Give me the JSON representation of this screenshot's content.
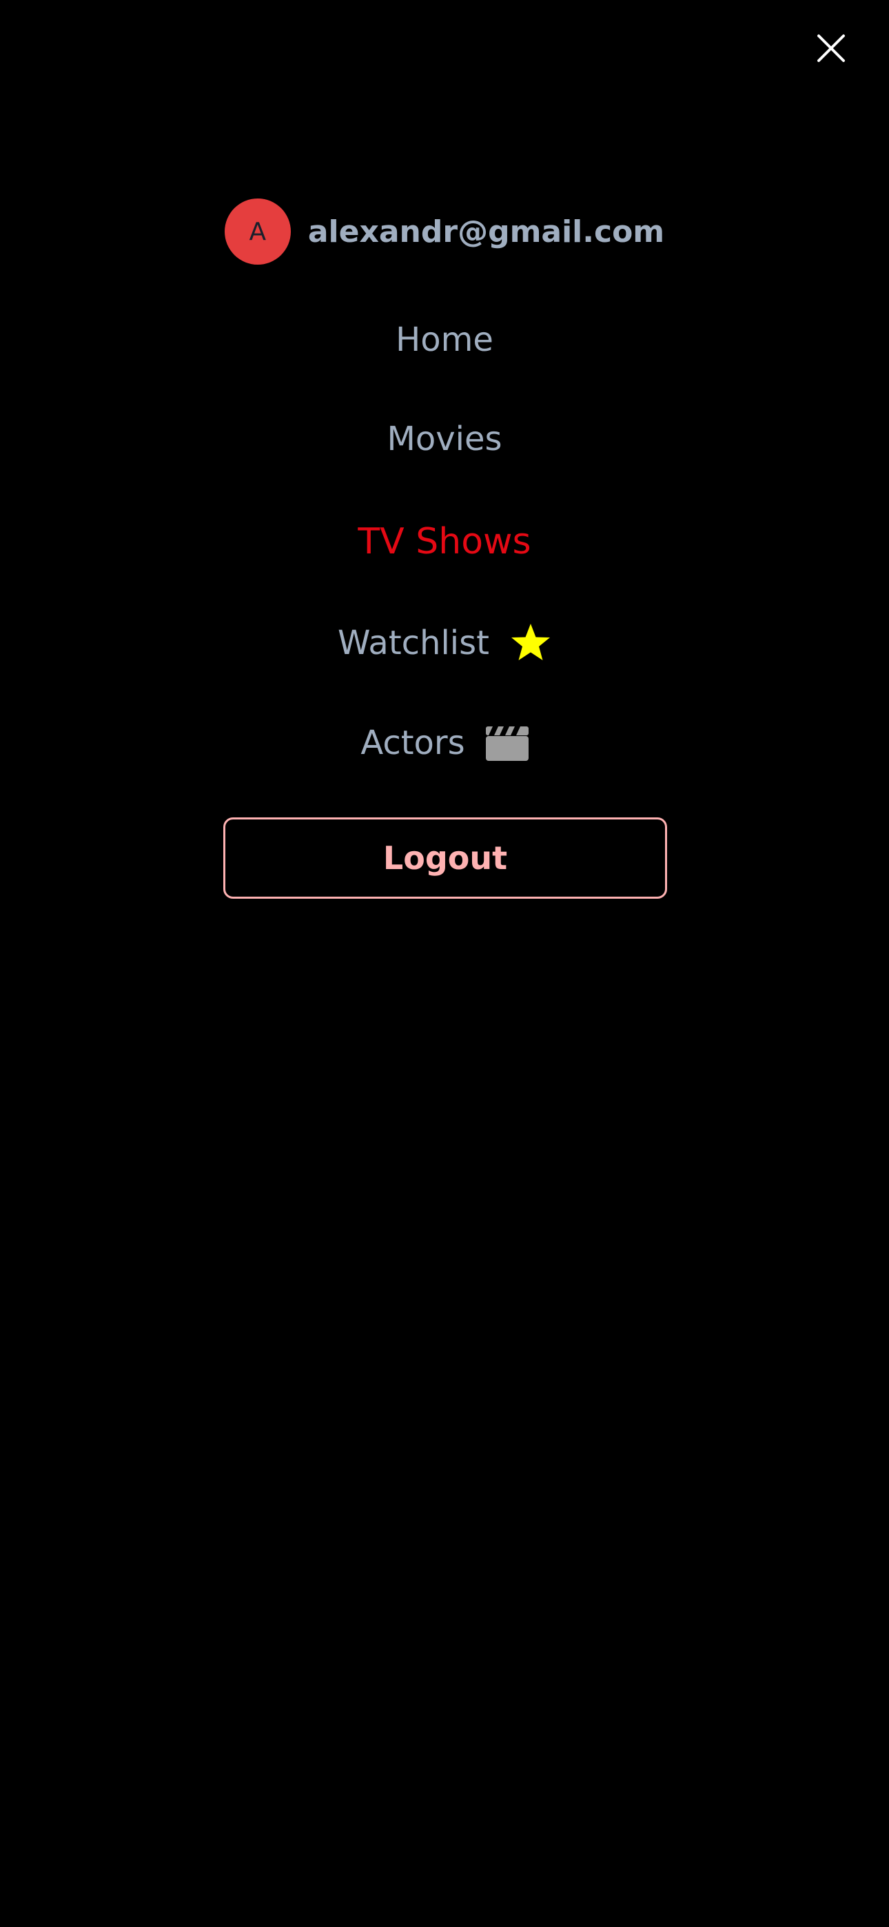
{
  "header": {
    "close_icon": "close-icon"
  },
  "user": {
    "avatar_initial": "A",
    "email": "alexandr@gmail.com",
    "avatar_color": "#e53e3e"
  },
  "nav": {
    "items": [
      {
        "label": "Home",
        "active": false
      },
      {
        "label": "Movies",
        "active": false
      },
      {
        "label": "TV Shows",
        "active": true
      },
      {
        "label": "Watchlist",
        "active": false,
        "icon": "star-icon"
      },
      {
        "label": "Actors",
        "active": false,
        "icon": "clapperboard-icon"
      }
    ]
  },
  "logout": {
    "label": "Logout"
  },
  "colors": {
    "background": "#000000",
    "text": "#a0aec0",
    "active": "#e50914",
    "star": "#ffff00",
    "logout": "#feb2b2"
  }
}
